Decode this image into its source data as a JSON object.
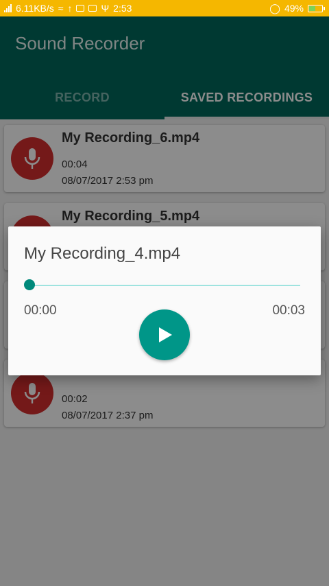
{
  "status_bar": {
    "speed": "6.11KB/s",
    "time": "2:53",
    "battery_percent": "49%",
    "battery_level": 0.49,
    "colors": {
      "background": "#f5b700"
    },
    "icons": [
      "signal-icon",
      "wifi-icon",
      "usb-icon",
      "mail-icon",
      "cat-app-icon",
      "usb-debug-icon",
      "alarm-icon",
      "battery-icon"
    ]
  },
  "app_bar": {
    "title": "Sound Recorder",
    "color": "#00695c"
  },
  "tabs": [
    {
      "label": "RECORD",
      "active": false
    },
    {
      "label": "SAVED RECORDINGS",
      "active": true
    }
  ],
  "recordings": [
    {
      "name": "My Recording_6.mp4",
      "duration": "00:04",
      "date": "08/07/2017 2:53 pm"
    },
    {
      "name": "My Recording_5.mp4",
      "duration": "",
      "date": ""
    },
    {
      "name": "",
      "duration": "",
      "date": ""
    },
    {
      "name": "",
      "duration": "00:02",
      "date": "08/07/2017 2:37 pm"
    }
  ],
  "player_dialog": {
    "title": "My Recording_4.mp4",
    "current_time": "00:00",
    "total_time": "00:03",
    "progress": 0,
    "play_icon": "play-icon",
    "accent": "#009688"
  }
}
